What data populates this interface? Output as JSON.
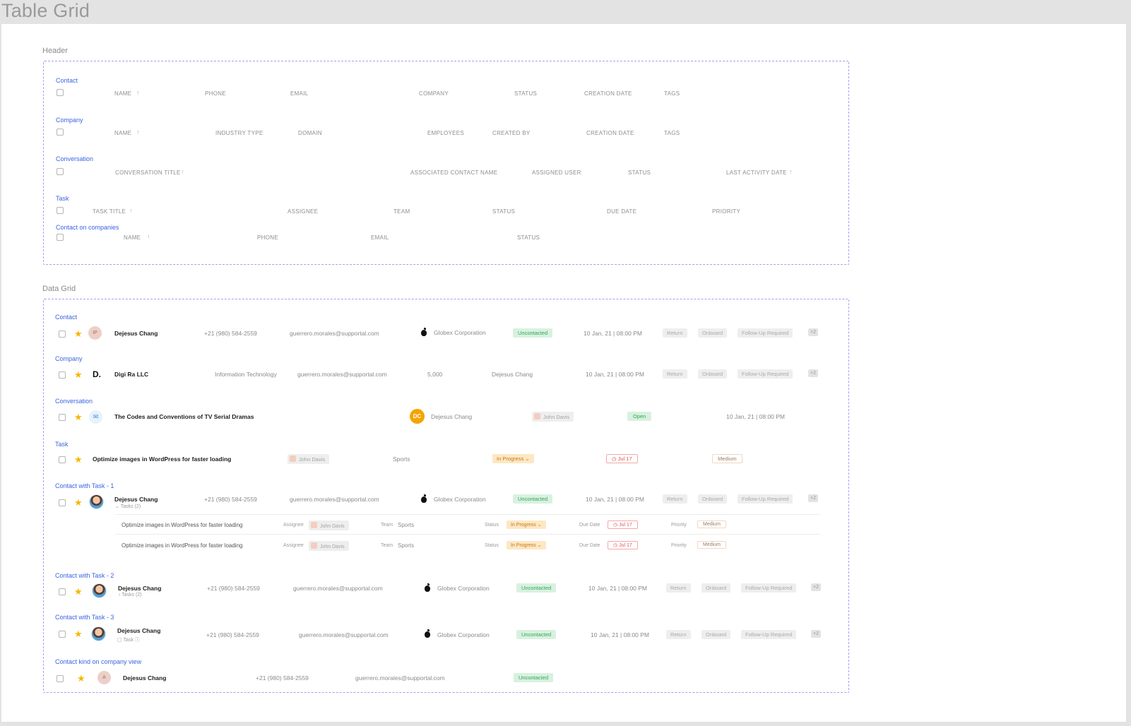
{
  "page_title": "Table Grid",
  "header_section": {
    "label": "Header",
    "groups": [
      {
        "title": "Contact",
        "columns": [
          "NAME",
          "PHONE",
          "EMAIL",
          "COMPANY",
          "STATUS",
          "CREATION DATE",
          "TAGS"
        ]
      },
      {
        "title": "Company",
        "columns": [
          "NAME",
          "INDUSTRY TYPE",
          "DOMAIN",
          "EMPLOYEES",
          "CREATED BY",
          "CREATION DATE",
          "TAGS"
        ]
      },
      {
        "title": "Conversation",
        "columns": [
          "CONVERSATION TITLE",
          "ASSOCIATED CONTACT NAME",
          "ASSIGNED USER",
          "STATUS",
          "LAST ACTIVITY DATE"
        ]
      },
      {
        "title": "Task",
        "columns": [
          "TASK TITLE",
          "ASSIGNEE",
          "TEAM",
          "STATUS",
          "DUE DATE",
          "PRIORITY"
        ]
      },
      {
        "title": "Contact on companies",
        "columns": [
          "NAME",
          "PHONE",
          "EMAIL",
          "STATUS"
        ]
      }
    ]
  },
  "data_section": {
    "label": "Data Grid",
    "contact": {
      "title": "Contact",
      "avatar": "IP",
      "name": "Dejesus Chang",
      "phone": "+21 (980) 584-2559",
      "email": "guerrero.morales@supportal.com",
      "company": "Globex Corporation",
      "status": "Uncontacted",
      "date": "10 Jan, 21 | 08:00 PM",
      "tags": [
        "Return",
        "Onboard",
        "Follow-Up Required"
      ],
      "more": "+2"
    },
    "company": {
      "title": "Company",
      "name": "Digi Ra LLC",
      "industry": "Information Technology",
      "email": "guerrero.morales@supportal.com",
      "employees": "5,000",
      "created_by": "Dejesus Chang",
      "date": "10 Jan, 21 | 08:00 PM",
      "tags": [
        "Return",
        "Onboard",
        "Follow-Up Required"
      ],
      "more": "+2"
    },
    "conversation": {
      "title": "Conversation",
      "conv_title": "The Codes and Conventions of TV Serial Dramas",
      "contact_initials": "DC",
      "contact": "Dejesus Chang",
      "assigned": "John Davis",
      "status": "Open",
      "date": "10 Jan, 21 | 08:00 PM"
    },
    "task": {
      "title": "Task",
      "task_title": "Optimize images in WordPress for faster loading",
      "assignee": "John Davis",
      "team": "Sports",
      "status": "In Progress",
      "due": "Jul 17",
      "priority": "Medium"
    },
    "contact_task_1": {
      "title": "Contact with Task - 1",
      "name": "Dejesus Chang",
      "sub": "Tasks (2)",
      "phone": "+21 (980) 584-2559",
      "email": "guerrero.morales@supportal.com",
      "company": "Globex Corporation",
      "status": "Uncontacted",
      "date": "10 Jan, 21 | 08:00 PM",
      "tags": [
        "Return",
        "Onboard",
        "Follow-Up Required"
      ],
      "more": "+2",
      "subtasks": [
        {
          "title": "Optimize images in WordPress for faster loading",
          "assignee_label": "Assignee",
          "assignee": "John Davis",
          "team_label": "Team",
          "team": "Sports",
          "status_label": "Status",
          "status": "In Progress",
          "due_label": "Due Date",
          "due": "Jul 17",
          "priority_label": "Priority",
          "priority": "Medium"
        },
        {
          "title": "Optimize images in WordPress for faster loading",
          "assignee_label": "Assignee",
          "assignee": "John Davis",
          "team_label": "Team",
          "team": "Sports",
          "status_label": "Status",
          "status": "In Progress",
          "due_label": "Due Date",
          "due": "Jul 17",
          "priority_label": "Priority",
          "priority": "Medium"
        }
      ]
    },
    "contact_task_2": {
      "title": "Contact with Task - 2",
      "name": "Dejesus Chang",
      "sub": "Tasks (2)",
      "phone": "+21 (980) 584-2559",
      "email": "guerrero.morales@supportal.com",
      "company": "Globex Corporation",
      "status": "Uncontacted",
      "date": "10 Jan, 21 | 08:00 PM",
      "tags": [
        "Return",
        "Onboard",
        "Follow-Up Required"
      ],
      "more": "+2"
    },
    "contact_task_3": {
      "title": "Contact with Task - 3",
      "name": "Dejesus Chang",
      "sub": "Task",
      "phone": "+21 (980) 584-2559",
      "email": "guerrero.morales@supportal.com",
      "company": "Globex Corporation",
      "status": "Uncontacted",
      "date": "10 Jan, 21 | 08:00 PM",
      "tags": [
        "Return",
        "Onboard",
        "Follow-Up Required"
      ],
      "more": "+2"
    },
    "contact_company_view": {
      "title": "Contact kind on company view",
      "avatar": "A",
      "name": "Dejesus Chang",
      "phone": "+21 (980) 584-2559",
      "email": "guerrero.morales@supportal.com",
      "status": "Uncontacted"
    }
  }
}
